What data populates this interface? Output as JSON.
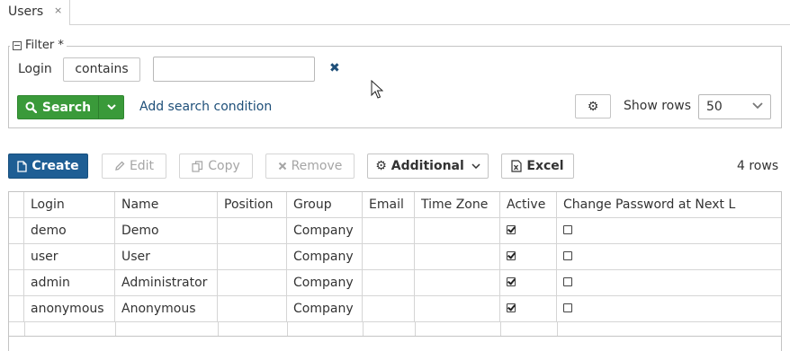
{
  "tab": {
    "title": "Users",
    "close": "×"
  },
  "filter": {
    "legend": "Filter *",
    "login_label": "Login",
    "operator": "contains",
    "login_value": "",
    "clear": "✖",
    "search_label": "Search",
    "add_condition": "Add search condition",
    "show_rows_label": "Show rows",
    "show_rows_value": "50"
  },
  "toolbar": {
    "create": "Create",
    "edit": "Edit",
    "copy": "Copy",
    "remove": "Remove",
    "additional": "Additional",
    "excel": "Excel",
    "rows_count": "4 rows"
  },
  "table": {
    "columns": [
      "Login",
      "Name",
      "Position",
      "Group",
      "Email",
      "Time Zone",
      "Active",
      "Change Password at Next L"
    ],
    "rows": [
      {
        "login": "demo",
        "name": "Demo",
        "position": "",
        "group": "Company",
        "email": "",
        "time_zone": "",
        "active": true,
        "change_password": false
      },
      {
        "login": "user",
        "name": "User",
        "position": "",
        "group": "Company",
        "email": "",
        "time_zone": "",
        "active": true,
        "change_password": false
      },
      {
        "login": "admin",
        "name": "Administrator",
        "position": "",
        "group": "Company",
        "email": "",
        "time_zone": "",
        "active": true,
        "change_password": false
      },
      {
        "login": "anonymous",
        "name": "Anonymous",
        "position": "",
        "group": "Company",
        "email": "",
        "time_zone": "",
        "active": true,
        "change_password": false
      }
    ]
  },
  "colors": {
    "primary": "#1e5e94",
    "success": "#3a9a3a",
    "link": "#1e4f79"
  }
}
